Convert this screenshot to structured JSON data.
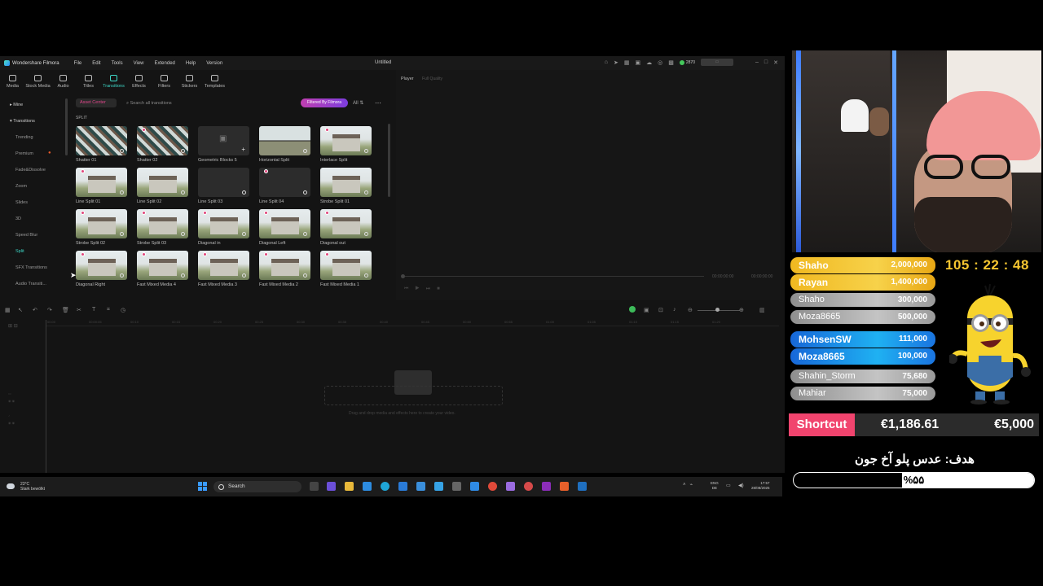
{
  "filmora": {
    "app_name": "Wondershare Filmora",
    "menu": [
      "File",
      "Edit",
      "Tools",
      "View",
      "Extended",
      "Help",
      "Version"
    ],
    "doc_title": "Untitled",
    "coins": "2870",
    "toolbar": [
      "Media",
      "Stock Media",
      "Audio",
      "Titles",
      "Transitions",
      "Effects",
      "Filters",
      "Stickers",
      "Templates"
    ],
    "active_tool": "Transitions",
    "sidebar": {
      "mine": "Mine",
      "transitions": "Transitions",
      "items": [
        "Trending",
        "Premium",
        "Fade&Dissolve",
        "Zoom",
        "Slides",
        "3D",
        "Speed Blur",
        "Split",
        "SFX Transitions",
        "Audio Transiti..."
      ],
      "active_item": "Split"
    },
    "library": {
      "asset_center": "Asset Center",
      "search_placeholder": "Search all transitions",
      "filmora_pill": "Filtered By Filmora",
      "view_toggle": "All",
      "section": "SPLIT",
      "items": [
        {
          "label": "Shatter 01",
          "style": "shatter",
          "vip": false
        },
        {
          "label": "Shatter 02",
          "style": "shatter",
          "vip": true
        },
        {
          "label": "Geometric Blocks 5",
          "style": "dark",
          "vip": false
        },
        {
          "label": "Horizontal Split",
          "style": "split",
          "vip": false
        },
        {
          "label": "Interlace Split",
          "style": "house",
          "vip": true
        },
        {
          "label": "Line Split 01",
          "style": "house",
          "vip": true
        },
        {
          "label": "Line Split 02",
          "style": "house",
          "vip": false
        },
        {
          "label": "Line Split 03",
          "style": "dark",
          "vip": false
        },
        {
          "label": "Line Split 04",
          "style": "dark",
          "vip": true
        },
        {
          "label": "Strobe Split 01",
          "style": "house",
          "vip": false
        },
        {
          "label": "Strobe Split 02",
          "style": "house",
          "vip": true
        },
        {
          "label": "Strobe Split 03",
          "style": "house",
          "vip": true
        },
        {
          "label": "Diagonal in",
          "style": "house",
          "vip": true
        },
        {
          "label": "Diagonal Left",
          "style": "house",
          "vip": true
        },
        {
          "label": "Diagonal out",
          "style": "house",
          "vip": true
        },
        {
          "label": "Diagonal Right",
          "style": "house",
          "vip": true
        },
        {
          "label": "Fast Mixed Media 4",
          "style": "house",
          "vip": true
        },
        {
          "label": "Fast Mixed Media 3",
          "style": "house",
          "vip": true
        },
        {
          "label": "Fast Mixed Media 2",
          "style": "house",
          "vip": true
        },
        {
          "label": "Fast Mixed Media 1",
          "style": "house",
          "vip": true
        }
      ]
    },
    "player": {
      "title": "Player",
      "quality": "Full Quality",
      "time_current": "00:00:00:00",
      "time_total": "00:00:00:00"
    },
    "timeline": {
      "ruler": [
        "00:00",
        "00:00:05",
        "00:10",
        "00:15",
        "00:20",
        "00:25",
        "00:30",
        "00:35",
        "00:40",
        "00:45",
        "00:50",
        "00:55",
        "01:00",
        "01:05",
        "01:10",
        "01:15",
        "01:20"
      ],
      "drop_hint": "Drag and drop media and effects here to create your video."
    }
  },
  "taskbar": {
    "weather_temp": "23°C",
    "weather_desc": "Stark bewölkt",
    "search": "Search",
    "lang": "ENG",
    "lang_sub": "DE",
    "time": "17:57",
    "date": "28/08/2025"
  },
  "leaderboard": [
    {
      "name": "Shaho",
      "amount": "2,000,000",
      "tier": "gold"
    },
    {
      "name": "Rayan",
      "amount": "1,400,000",
      "tier": "gold"
    },
    {
      "name": "Shaho",
      "amount": "300,000",
      "tier": "silver"
    },
    {
      "name": "Moza8665",
      "amount": "500,000",
      "tier": "silver"
    },
    {
      "name": "MohsenSW",
      "amount": "111,000",
      "tier": "blue"
    },
    {
      "name": "Moza8665",
      "amount": "100,000",
      "tier": "blue"
    },
    {
      "name": "Shahin_Storm",
      "amount": "75,680",
      "tier": "silver"
    },
    {
      "name": "Mahiar",
      "amount": "75,000",
      "tier": "silver"
    }
  ],
  "timer": "105 : 22 : 48",
  "shortcut": {
    "label": "Shortcut",
    "current": "€1,186.61",
    "goal": "€5,000"
  },
  "goal": {
    "title": "هدف: عدس پلو آخ جون",
    "percent_text": "%۵۵",
    "fraction": 0.55
  },
  "colors": {
    "accent": "#3dd6c6",
    "gold": "#f6c630",
    "pink": "#f1446e"
  }
}
